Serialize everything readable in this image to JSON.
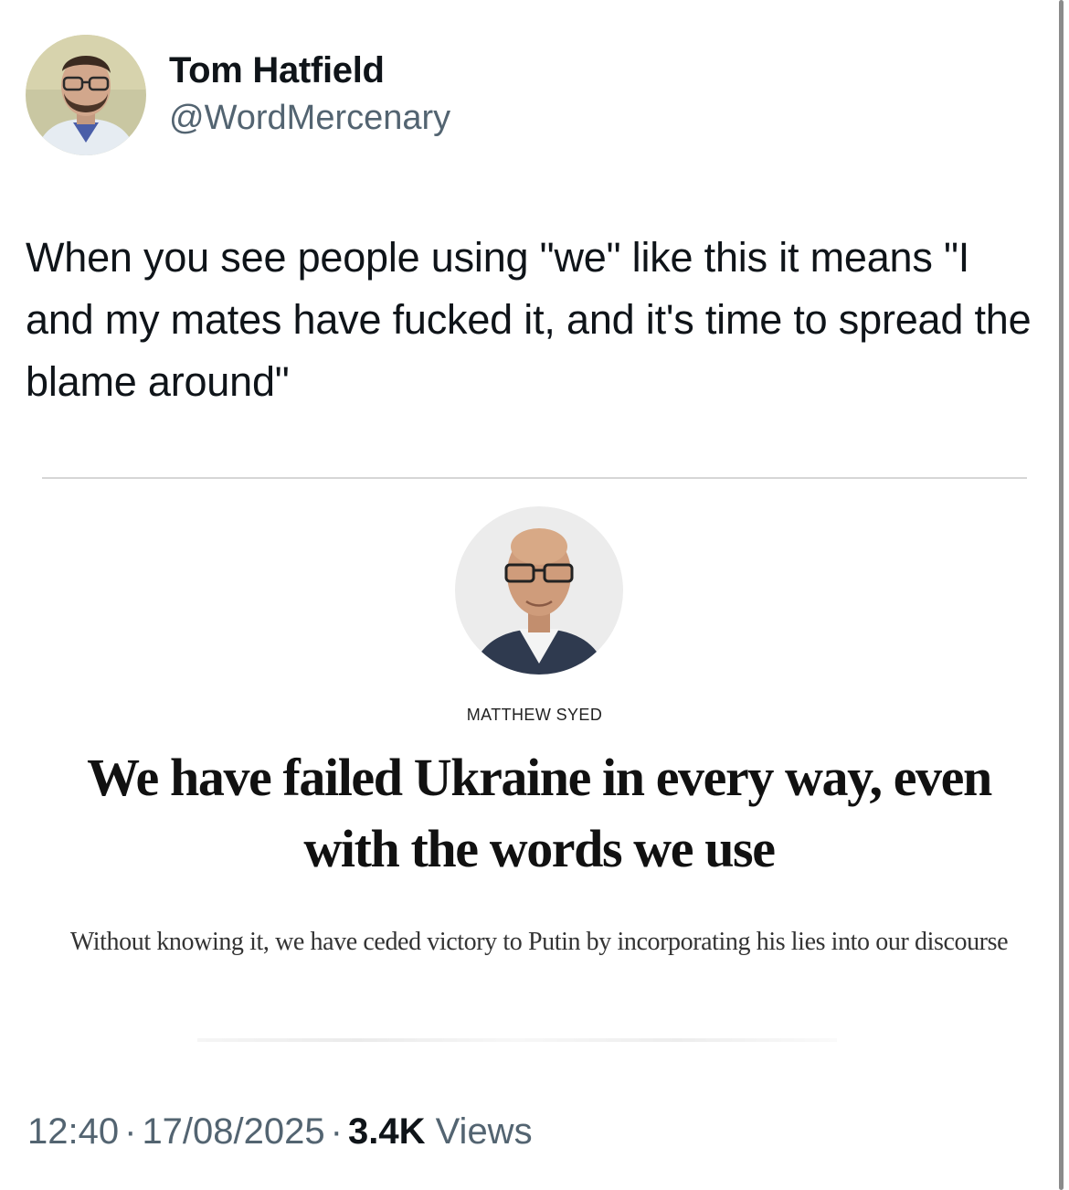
{
  "tweet": {
    "author": {
      "display_name": "Tom Hatfield",
      "handle": "@WordMercenary"
    },
    "text": "When you see people using \"we\" like this it means \"I and my mates have fucked it, and it's time to spread the blame around\"",
    "attached_article": {
      "byline": "MATTHEW SYED",
      "headline": "We have failed Ukraine in every way, even with the words we use",
      "standfirst": "Without knowing it, we have ceded victory to Putin by incorporating his lies into our discourse"
    },
    "meta": {
      "time": "12:40",
      "separator": "·",
      "date": "17/08/2025",
      "views_count": "3.4K",
      "views_label": "Views"
    }
  },
  "colors": {
    "text_primary": "#0f1419",
    "text_secondary": "#536471",
    "divider": "#d6d6d6",
    "background": "#ffffff"
  }
}
